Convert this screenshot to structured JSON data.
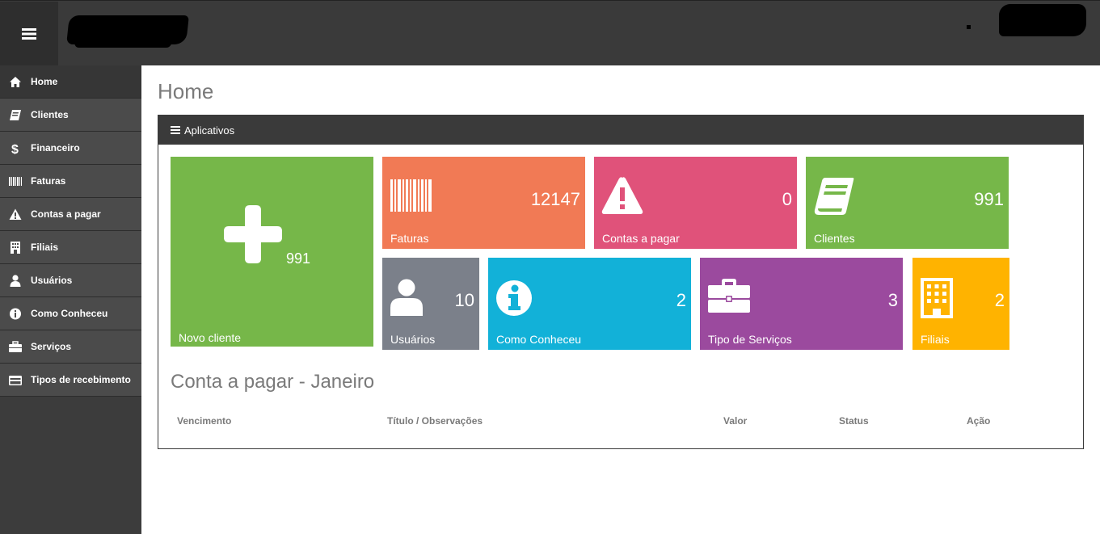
{
  "colors": {
    "topbar": "#3a3a3a",
    "sidebar": "#3c3c3c",
    "green": "#76b749",
    "orange": "#f17a55",
    "pink": "#e0527a",
    "gray": "#7b808a",
    "cyan": "#12b1d8",
    "purple": "#9b4a9e",
    "amber": "#ffb300"
  },
  "sidebar": {
    "items": [
      {
        "label": "Home",
        "icon": "home-icon"
      },
      {
        "label": "Clientes",
        "icon": "book-icon"
      },
      {
        "label": "Financeiro",
        "icon": "dollar-icon"
      },
      {
        "label": "Faturas",
        "icon": "barcode-icon"
      },
      {
        "label": "Contas a pagar",
        "icon": "warning-icon"
      },
      {
        "label": "Filiais",
        "icon": "building-icon"
      },
      {
        "label": "Usuários",
        "icon": "user-icon"
      },
      {
        "label": "Como Conheceu",
        "icon": "info-icon"
      },
      {
        "label": "Serviços",
        "icon": "briefcase-icon"
      },
      {
        "label": "Tipos de recebimento",
        "icon": "credit-card-icon"
      }
    ]
  },
  "page": {
    "title": "Home"
  },
  "panel": {
    "title": "Aplicativos"
  },
  "tiles": {
    "novo_cliente": {
      "label": "Novo cliente",
      "count": "991",
      "icon": "plus-icon"
    },
    "faturas": {
      "label": "Faturas",
      "count": "12147",
      "icon": "barcode-icon"
    },
    "contas_pagar": {
      "label": "Contas a pagar",
      "count": "0",
      "icon": "warning-icon"
    },
    "clientes": {
      "label": "Clientes",
      "count": "991",
      "icon": "book-icon"
    },
    "usuarios": {
      "label": "Usuários",
      "count": "10",
      "icon": "user-icon"
    },
    "como_conheceu": {
      "label": "Como Conheceu",
      "count": "2",
      "icon": "info-icon"
    },
    "tipo_servicos": {
      "label": "Tipo de Serviços",
      "count": "3",
      "icon": "briefcase-icon"
    },
    "filiais": {
      "label": "Filiais",
      "count": "2",
      "icon": "building-icon"
    }
  },
  "bills": {
    "title": "Conta a pagar - Janeiro",
    "columns": [
      "Vencimento",
      "Título / Observações",
      "Valor",
      "Status",
      "Ação"
    ]
  }
}
